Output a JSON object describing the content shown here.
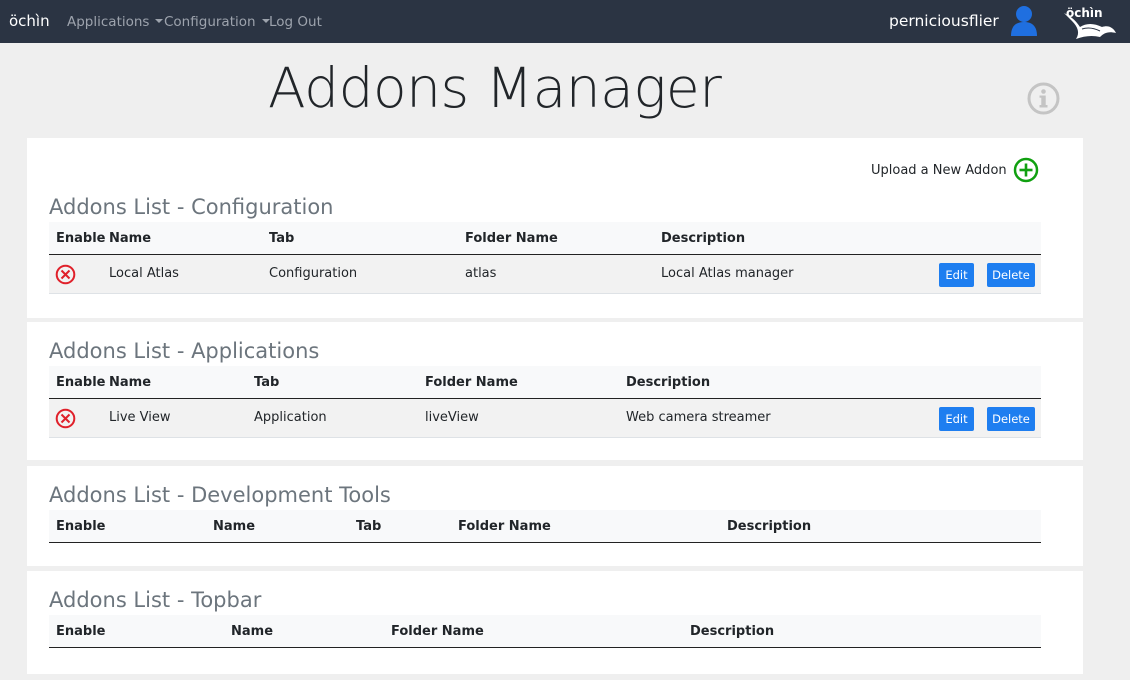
{
  "nav": {
    "brand": "öchìn",
    "items": [
      {
        "label": "Applications",
        "dropdown": true
      },
      {
        "label": "Configuration",
        "dropdown": true
      },
      {
        "label": "Log Out",
        "dropdown": false
      }
    ],
    "username": "perniciousflier",
    "user_icon": "user-icon",
    "logo_text": "öchìn"
  },
  "page": {
    "title": "Addons Manager",
    "info_icon": "info-icon",
    "upload_label": "Upload a New Addon",
    "upload_icon": "plus-circle-icon"
  },
  "sections": [
    {
      "title": "Addons List - Configuration",
      "headers": [
        "Enable",
        "Name",
        "Tab",
        "Folder Name",
        "Description"
      ],
      "rows": [
        {
          "name": "Local Atlas",
          "tab": "Configuration",
          "folder": "atlas",
          "description": "Local Atlas manager",
          "edit": "Edit",
          "delete": "Delete"
        }
      ]
    },
    {
      "title": "Addons List - Applications",
      "headers": [
        "Enable",
        "Name",
        "Tab",
        "Folder Name",
        "Description"
      ],
      "rows": [
        {
          "name": "Live View",
          "tab": "Application",
          "folder": "liveView",
          "description": "Web camera streamer",
          "edit": "Edit",
          "delete": "Delete"
        }
      ]
    },
    {
      "title": "Addons List - Development Tools",
      "headers": [
        "Enable",
        "Name",
        "Tab",
        "Folder Name",
        "Description"
      ],
      "rows": []
    },
    {
      "title": "Addons List - Topbar",
      "headers": [
        "Enable",
        "Name",
        "Folder Name",
        "Description"
      ],
      "rows": []
    }
  ],
  "colors": {
    "navbar": "#2b3443",
    "button": "#1e7ef0",
    "disabled_icon": "#e0202a",
    "add_icon": "#10a010"
  }
}
